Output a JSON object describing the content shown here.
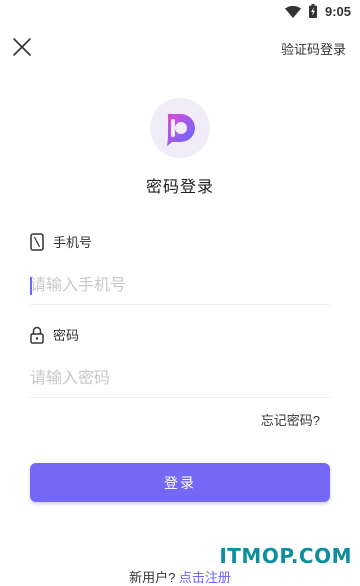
{
  "status_bar": {
    "time": "9:05",
    "wifi_icon": "wifi-icon",
    "battery_icon": "battery-charging-icon"
  },
  "header": {
    "close_icon": "close-icon",
    "sms_login_label": "验证码登录"
  },
  "logo": {
    "icon": "app-logo-icon",
    "colors": {
      "bg": "#f1ecfa",
      "gradient_start": "#5a6cff",
      "gradient_end": "#e34bd3"
    }
  },
  "title": "密码登录",
  "phone": {
    "label": "手机号",
    "icon": "phone-icon",
    "placeholder": "请输入手机号",
    "value": ""
  },
  "password": {
    "label": "密码",
    "icon": "lock-icon",
    "placeholder": "请输入密码",
    "value": ""
  },
  "forgot_password_label": "忘记密码?",
  "login_button_label": "登录",
  "signup": {
    "prompt": "新用户?",
    "link_label": "点击注册"
  },
  "watermark": "ITMOP.COM",
  "colors": {
    "accent": "#7468f6",
    "link": "#6f66ff",
    "text": "#333333",
    "placeholder": "#c8c8c8"
  }
}
